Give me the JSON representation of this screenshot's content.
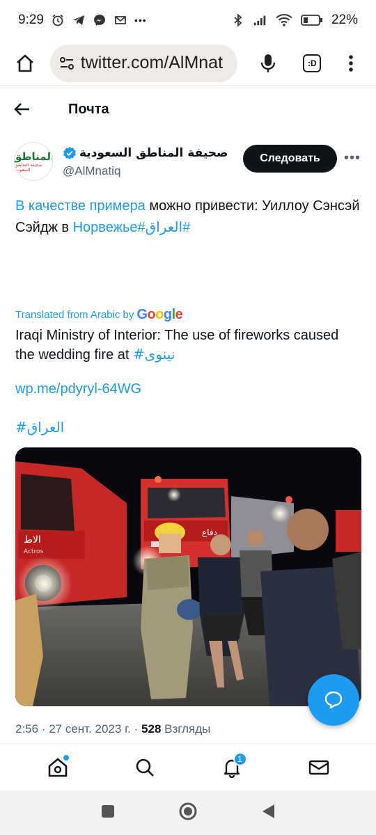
{
  "status_bar": {
    "time": "9:29",
    "dots": "•••",
    "battery": "22%"
  },
  "browser": {
    "url": "twitter.com/AlMnat"
  },
  "header": {
    "title": "Почта"
  },
  "tweet": {
    "author_name": "صحيفة المناطق السعودية",
    "author_handle": "@AlMnatiq",
    "follow_label": "Следовать",
    "more": "•••",
    "avatar_logo": "المناطق",
    "avatar_sub": "صحيفة المناطق السعودية",
    "text_link1": "В качестве примера",
    "text_part1": " можно привести: Уиллоу Сэнсэй Сэйдж в ",
    "text_link2": " Норвежье#العراق#",
    "translated_label": "Translated from Arabic by",
    "google": "Google",
    "translation_part1": "Iraqi Ministry of Interior: The use of fireworks caused the wedding fire at ",
    "translation_hashtag": "#نينوى",
    "link": "wp.me/pdyryl-64WG",
    "hashtag": "#العراق",
    "truck_text_1": "الاط",
    "truck_text_2": "Actros",
    "truck_text_3": "دفاع",
    "time": "2:56",
    "date": "27 сент. 2023 г.",
    "views_count": "528",
    "views_label": "Взгляды"
  },
  "bottom_nav": {
    "notifications_badge": "1"
  },
  "colors": {
    "accent": "#1d9bf0",
    "text": "#0f1419",
    "secondary": "#536471"
  }
}
